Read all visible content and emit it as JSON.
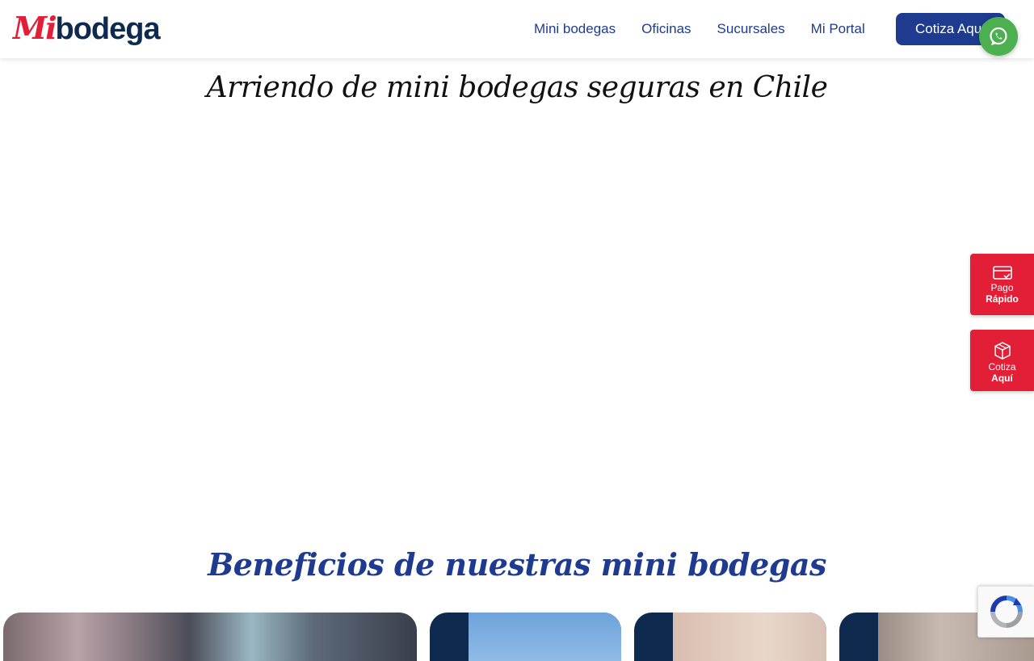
{
  "header": {
    "logo": {
      "mi": "Mi",
      "bodega": "bodega"
    },
    "nav": [
      {
        "label": "Mini bodegas"
      },
      {
        "label": "Oficinas"
      },
      {
        "label": "Sucursales"
      },
      {
        "label": "Mi Portal"
      }
    ],
    "cta_label": "Cotiza Aquí"
  },
  "hero": {
    "title": "Arriendo de mini bodegas seguras en Chile"
  },
  "benefits": {
    "title": "Beneficios de nuestras mini bodegas"
  },
  "side_buttons": [
    {
      "line1": "Pago",
      "line2": "Rápido",
      "icon": "card-check-icon"
    },
    {
      "line1": "Cotiza",
      "line2": "Aquí",
      "icon": "box-icon"
    }
  ],
  "icons": {
    "whatsapp": "whatsapp-icon",
    "recaptcha": "recaptcha-icon"
  },
  "colors": {
    "brand_blue": "#1f3b8f",
    "brand_red": "#e31e37",
    "brand_navy": "#0e2a4f",
    "whatsapp_green": "#4caf50"
  }
}
